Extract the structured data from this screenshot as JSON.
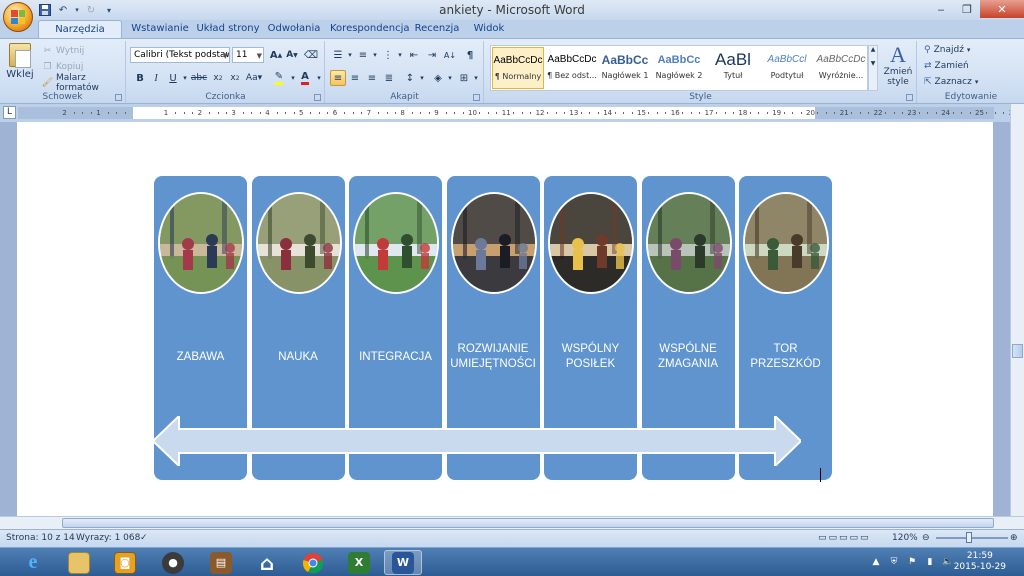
{
  "window": {
    "title": "ankiety - Microsoft Word",
    "controls": {
      "minimize": "‒",
      "restore": "❐",
      "close": "✕"
    }
  },
  "tabs": [
    "Narzędzia główne",
    "Wstawianie",
    "Układ strony",
    "Odwołania",
    "Korespondencja",
    "Recenzja",
    "Widok"
  ],
  "ribbon": {
    "clipboard": {
      "label": "Schowek",
      "paste": "Wklej",
      "cut": "Wytnij",
      "copy": "Kopiuj",
      "format_painter": "Malarz formatów"
    },
    "font": {
      "label": "Czcionka",
      "font_name": "Calibri (Tekst podstawo",
      "font_size": "11"
    },
    "paragraph": {
      "label": "Akapit"
    },
    "styles": {
      "label": "Style",
      "items": [
        {
          "sample": "AaBbCcDc",
          "name": "¶ Normalny"
        },
        {
          "sample": "AaBbCcDc",
          "name": "¶ Bez odst..."
        },
        {
          "sample": "AaBbCc",
          "name": "Nagłówek 1"
        },
        {
          "sample": "AaBbCc",
          "name": "Nagłówek 2"
        },
        {
          "sample": "AaBl",
          "name": "Tytuł"
        },
        {
          "sample": "AaBbCcl",
          "name": "Podtytuł"
        },
        {
          "sample": "AaBbCcDc",
          "name": "Wyróżnie..."
        }
      ],
      "change_styles": "Zmień style"
    },
    "editing": {
      "label": "Edytowanie",
      "find": "Znajdź",
      "replace": "Zamień",
      "select": "Zaznacz"
    }
  },
  "ruler": {
    "numbers": [
      "2",
      "1",
      "1",
      "2",
      "3",
      "4",
      "5",
      "6",
      "7",
      "8",
      "9",
      "10",
      "11",
      "12",
      "13",
      "14",
      "15",
      "16",
      "17",
      "18",
      "19",
      "20",
      "21",
      "22",
      "23",
      "24",
      "25",
      "26",
      "27"
    ]
  },
  "diagram": {
    "columns": [
      {
        "label": "ZABAWA",
        "photo": "children-playing-forest"
      },
      {
        "label": "NAUKA",
        "photo": "children-birch-forest"
      },
      {
        "label": "INTEGRACJA",
        "photo": "children-circle-park"
      },
      {
        "label": "ROZWIJANIE\nUMIEJĘTNOŚCI",
        "photo": "girl-at-laptop"
      },
      {
        "label": "WSPÓLNY\nPOSIŁEK",
        "photo": "group-meal-table"
      },
      {
        "label": "WSPÓLNE\nZMAGANIA",
        "photo": "children-rope-net"
      },
      {
        "label": "TOR\nPRZESZKÓD",
        "photo": "obstacle-course-forest"
      }
    ],
    "colors": {
      "column": "#5f94cf",
      "arrow": "#c9d9ee",
      "arrow_stroke": "#ffffff"
    }
  },
  "statusbar": {
    "page": "Strona: 10 z 14",
    "words": "Wyrazy: 1 068",
    "zoom": "120%"
  },
  "taskbar": {
    "time": "21:59",
    "date": "2015-10-29"
  }
}
